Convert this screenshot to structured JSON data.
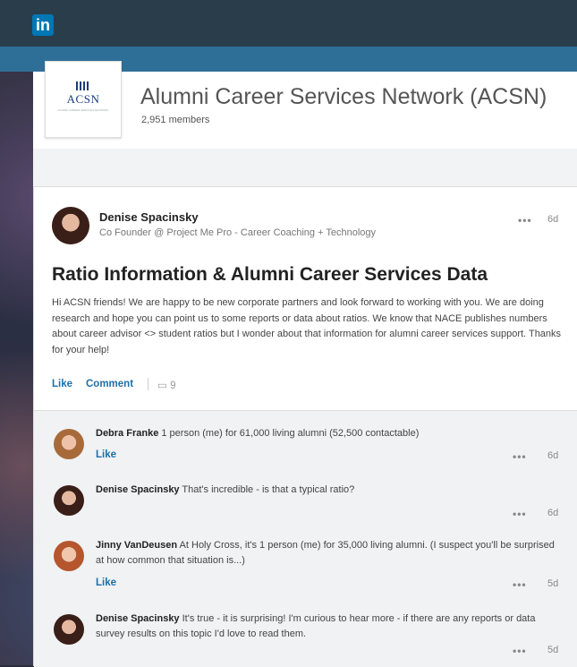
{
  "app": {
    "logo_text": "in"
  },
  "group": {
    "logo_acronym": "ACSN",
    "logo_subtitle": "ALUMNI CAREER SERVICES NETWORK",
    "title": "Alumni Career Services Network (ACSN)",
    "members": "2,951 members"
  },
  "post": {
    "author": "Denise Spacinsky",
    "headline": "Co Founder @ Project Me Pro - Career Coaching + Technology",
    "time": "6d",
    "menu": "•••",
    "title": "Ratio Information & Alumni Career Services Data",
    "body": "Hi ACSN friends! We are happy to be new corporate partners and look forward to working with you. We are doing research and hope you can point us to some reports or data about ratios. We know that NACE publishes numbers about career advisor <> student ratios but I wonder about that information for alumni career services support. Thanks for your help!",
    "like_label": "Like",
    "comment_label": "Comment",
    "comment_count": "9"
  },
  "comments": [
    {
      "author": "Debra Franke",
      "text": "1 person (me) for 61,000 living alumni (52,500 contactable)",
      "like_label": "Like",
      "menu": "•••",
      "time": "6d"
    },
    {
      "author": "Denise Spacinsky",
      "text": "That's incredible - is that a typical ratio?",
      "like_label": "",
      "menu": "•••",
      "time": "6d"
    },
    {
      "author": "Jinny VanDeusen",
      "text": "At Holy Cross, it's 1 person (me) for 35,000 living alumni. (I suspect you'll be surprised at how common that situation is...)",
      "like_label": "Like",
      "menu": "•••",
      "time": "5d"
    },
    {
      "author": "Denise Spacinsky",
      "text": "It's true - it is surprising! I'm curious to hear more - if there are any reports or data survey results on this topic I'd love to read them.",
      "like_label": "",
      "menu": "•••",
      "time": "5d"
    }
  ]
}
